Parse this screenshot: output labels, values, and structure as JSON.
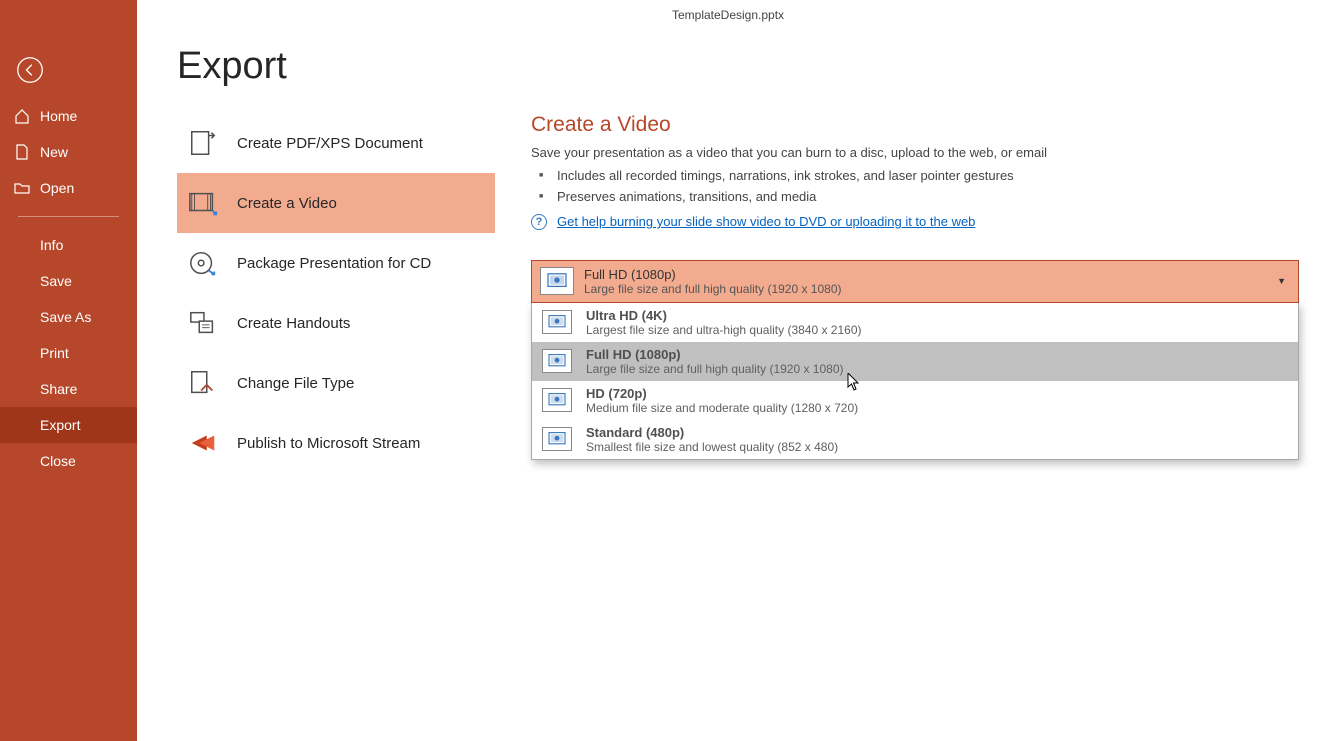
{
  "titlebar": {
    "filename": "TemplateDesign.pptx"
  },
  "sidebar": {
    "home": "Home",
    "new": "New",
    "open": "Open",
    "info": "Info",
    "save": "Save",
    "save_as": "Save As",
    "print": "Print",
    "share": "Share",
    "export": "Export",
    "close": "Close"
  },
  "page": {
    "title": "Export"
  },
  "export_options": {
    "pdf": "Create PDF/XPS Document",
    "video": "Create a Video",
    "package": "Package Presentation for CD",
    "handouts": "Create Handouts",
    "filetype": "Change File Type",
    "stream": "Publish to Microsoft Stream"
  },
  "video_panel": {
    "heading": "Create a Video",
    "description": "Save your presentation as a video that you can burn to a disc, upload to the web, or email",
    "bullets": [
      "Includes all recorded timings, narrations, ink strokes, and laser pointer gestures",
      "Preserves animations, transitions, and media"
    ],
    "help_text": "Get help burning your slide show video to DVD or uploading it to the web"
  },
  "resolution_selected": {
    "title": "Full HD (1080p)",
    "sub": "Large file size and full high quality (1920 x 1080)"
  },
  "resolution_options": [
    {
      "title": "Ultra HD (4K)",
      "sub": "Largest file size and ultra-high quality (3840 x 2160)",
      "highlight": false
    },
    {
      "title": "Full HD (1080p)",
      "sub": "Large file size and full high quality (1920 x 1080)",
      "highlight": true
    },
    {
      "title": "HD (720p)",
      "sub": "Medium file size and moderate quality (1280 x 720)",
      "highlight": false
    },
    {
      "title": "Standard (480p)",
      "sub": "Smallest file size and lowest quality (852 x 480)",
      "highlight": false
    }
  ]
}
